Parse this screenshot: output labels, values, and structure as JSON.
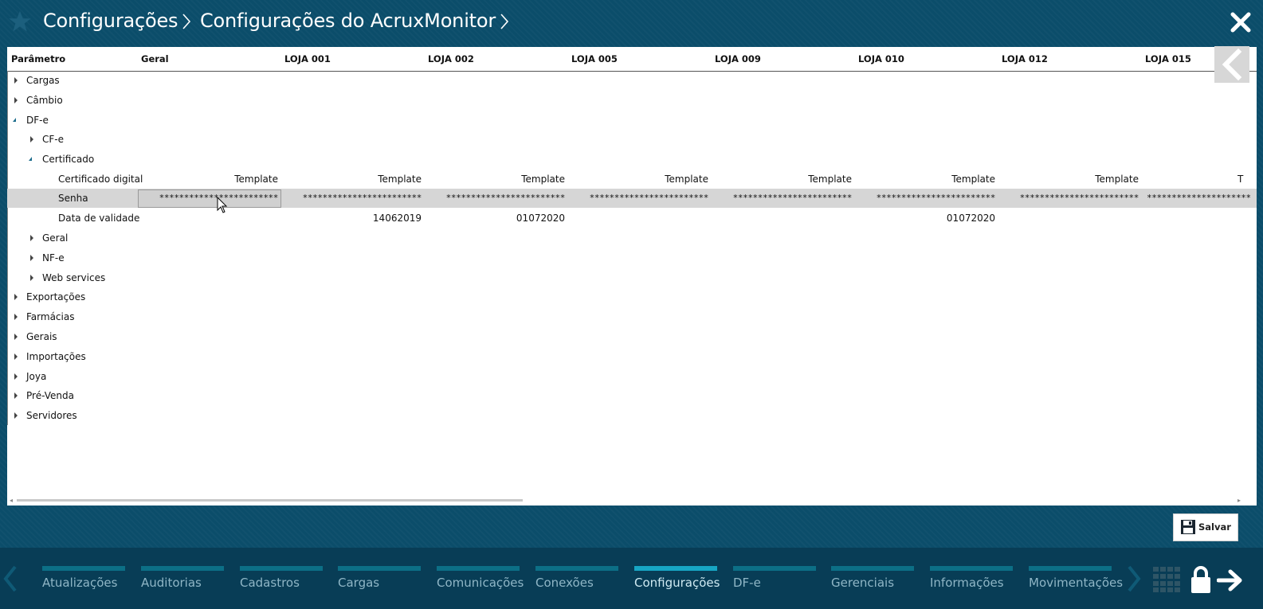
{
  "header": {
    "breadcrumb": [
      "Configurações",
      "Configurações do AcruxMonitor"
    ],
    "icons": {
      "favorite": "star-icon",
      "close": "close-icon"
    }
  },
  "grid": {
    "columns": [
      "Parâmetro",
      "Geral",
      "LOJA 001",
      "LOJA 002",
      "LOJA 005",
      "LOJA 009",
      "LOJA 010",
      "LOJA 012",
      "LOJA 015"
    ],
    "tree": [
      {
        "label": "Cargas",
        "state": "collapsed",
        "level": 0
      },
      {
        "label": "Câmbio",
        "state": "collapsed",
        "level": 0
      },
      {
        "label": "DF-e",
        "state": "expanded",
        "level": 0
      },
      {
        "label": "CF-e",
        "state": "collapsed",
        "level": 1
      },
      {
        "label": "Certificado",
        "state": "expanded",
        "level": 1
      },
      {
        "label": "Certificado digital",
        "state": "leaf",
        "level": 2,
        "values": [
          "Template",
          "Template",
          "Template",
          "Template",
          "Template",
          "Template",
          "Template",
          "T"
        ]
      },
      {
        "label": "Senha",
        "state": "leaf",
        "level": 2,
        "selected": true,
        "values": [
          "************************",
          "************************",
          "************************",
          "************************",
          "************************",
          "************************",
          "************************",
          "**************************"
        ]
      },
      {
        "label": "Data de validade",
        "state": "leaf",
        "level": 2,
        "values": [
          "",
          "14062019",
          "01072020",
          "",
          "",
          "01072020",
          "",
          ""
        ]
      },
      {
        "label": "Geral",
        "state": "collapsed",
        "level": 1
      },
      {
        "label": "NF-e",
        "state": "collapsed",
        "level": 1
      },
      {
        "label": "Web services",
        "state": "collapsed",
        "level": 1
      },
      {
        "label": "Exportações",
        "state": "collapsed",
        "level": 0
      },
      {
        "label": "Farmácias",
        "state": "collapsed",
        "level": 0
      },
      {
        "label": "Gerais",
        "state": "collapsed",
        "level": 0
      },
      {
        "label": "Importações",
        "state": "collapsed",
        "level": 0
      },
      {
        "label": "Joya",
        "state": "collapsed",
        "level": 0
      },
      {
        "label": "Pré-Venda",
        "state": "collapsed",
        "level": 0
      },
      {
        "label": "Servidores",
        "state": "collapsed",
        "level": 0
      }
    ]
  },
  "actions": {
    "save_label": "Salvar"
  },
  "nav": {
    "items": [
      {
        "label": "Atualizações",
        "active": false
      },
      {
        "label": "Auditorias",
        "active": false
      },
      {
        "label": "Cadastros",
        "active": false
      },
      {
        "label": "Cargas",
        "active": false
      },
      {
        "label": "Comunicações",
        "active": false
      },
      {
        "label": "Conexões",
        "active": false
      },
      {
        "label": "Configurações",
        "active": true
      },
      {
        "label": "DF-e",
        "active": false
      },
      {
        "label": "Gerenciais",
        "active": false
      },
      {
        "label": "Informações",
        "active": false
      },
      {
        "label": "Movimentações",
        "active": false
      }
    ]
  },
  "colors": {
    "background": "#0b4d6a",
    "nav_background": "#083d56",
    "nav_accent": "#0c6f86",
    "nav_active": "#17a6c4",
    "selected_row": "#d6d6d6"
  }
}
